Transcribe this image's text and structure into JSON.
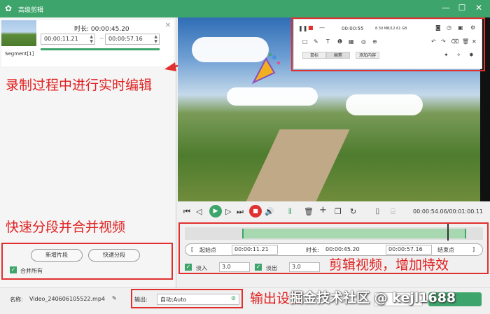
{
  "window": {
    "title": "高级剪辑",
    "minimize": "—",
    "maximize": "☐",
    "close": "✕"
  },
  "segment": {
    "label": "Segment[1]",
    "duration_label": "时长:",
    "duration": "00:00:45.20",
    "start": "00:00:11.21",
    "end": "00:00:57.16"
  },
  "annotations": {
    "realtime": "录制过程中进行实时编辑",
    "split_merge": "快速分段并合并视频",
    "output": "输出设置",
    "edit": "剪辑视频，增加特效"
  },
  "left_actions": {
    "new_segment": "新增片段",
    "quick_split": "快速分段",
    "merge_all": "合并所有"
  },
  "recorder_toolbar": {
    "timer": "00:00:55",
    "size": "8.30 MB/12.61 GB",
    "tab1": "鼠标",
    "tab2": "画笔",
    "tab3": "添加内容"
  },
  "playback": {
    "current_total": "00:00:54.06/00:01:00.11"
  },
  "edit": {
    "start_point": "起始点",
    "start_time": "00:00:11.21",
    "duration_label": "时长:",
    "duration": "00:00:45.20",
    "end_time": "00:00:57.16",
    "end_point": "结束点",
    "fade_in": "淡入",
    "fade_in_value": "3.0",
    "fade_out": "淡出",
    "fade_out_value": "3.0"
  },
  "bottom": {
    "name_label": "名称:",
    "filename": "Video_240606105522.mp4",
    "output_label": "输出:",
    "output_value": "自动;Auto"
  },
  "watermark": "掘金技术社区 @ kejl1688"
}
